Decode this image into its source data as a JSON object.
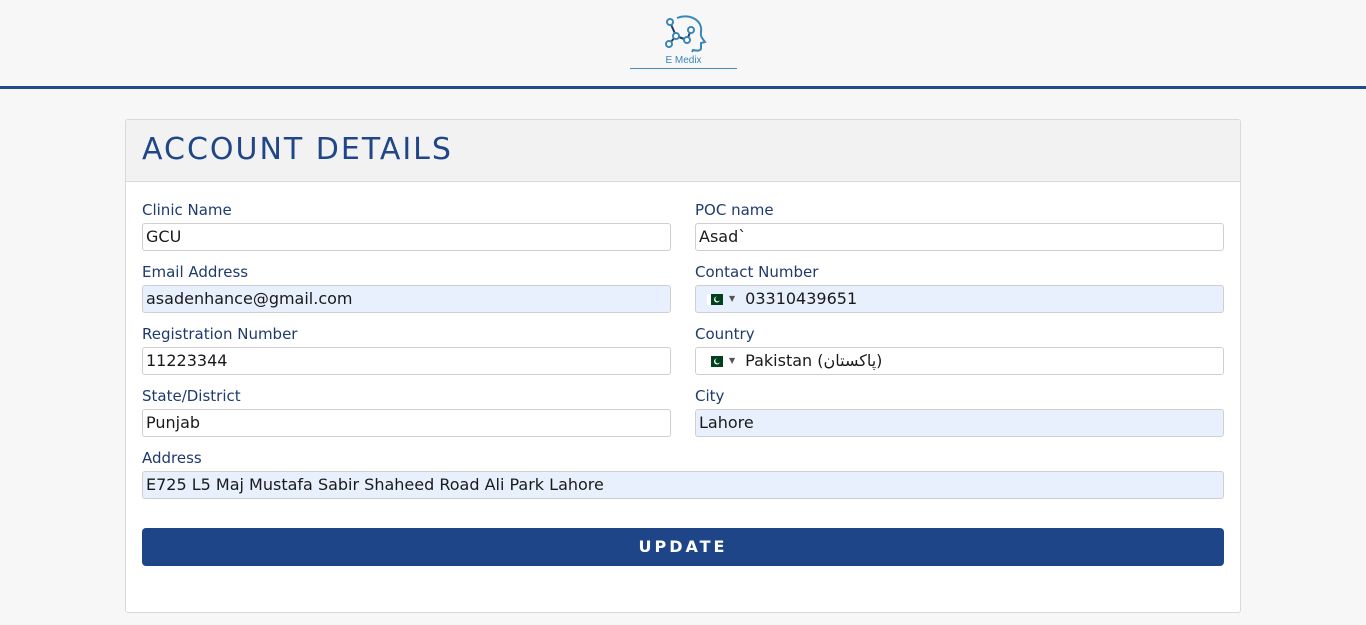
{
  "header": {
    "logo_text": "E Medix"
  },
  "page": {
    "title": "ACCOUNT DETAILS"
  },
  "form": {
    "clinic_name": {
      "label": "Clinic Name",
      "value": "GCU"
    },
    "poc_name": {
      "label": "POC name",
      "value": "Asad`"
    },
    "email": {
      "label": "Email Address",
      "value": "asadenhance@gmail.com"
    },
    "contact": {
      "label": "Contact Number",
      "value": "03310439651",
      "flag": "pakistan-flag-icon"
    },
    "registration": {
      "label": "Registration Number",
      "value": "11223344"
    },
    "country": {
      "label": "Country",
      "value": "Pakistan (‫پاکستان‬‎)",
      "flag": "pakistan-flag-icon"
    },
    "state": {
      "label": "State/District",
      "value": "Punjab"
    },
    "city": {
      "label": "City",
      "value": "Lahore"
    },
    "address": {
      "label": "Address",
      "value": "E725 L5 Maj Mustafa Sabir Shaheed Road Ali Park Lahore"
    },
    "submit_label": "UPDATE"
  },
  "colors": {
    "accent": "#1d4587",
    "label": "#1e3a6e",
    "autofill": "#e8f0fe"
  }
}
